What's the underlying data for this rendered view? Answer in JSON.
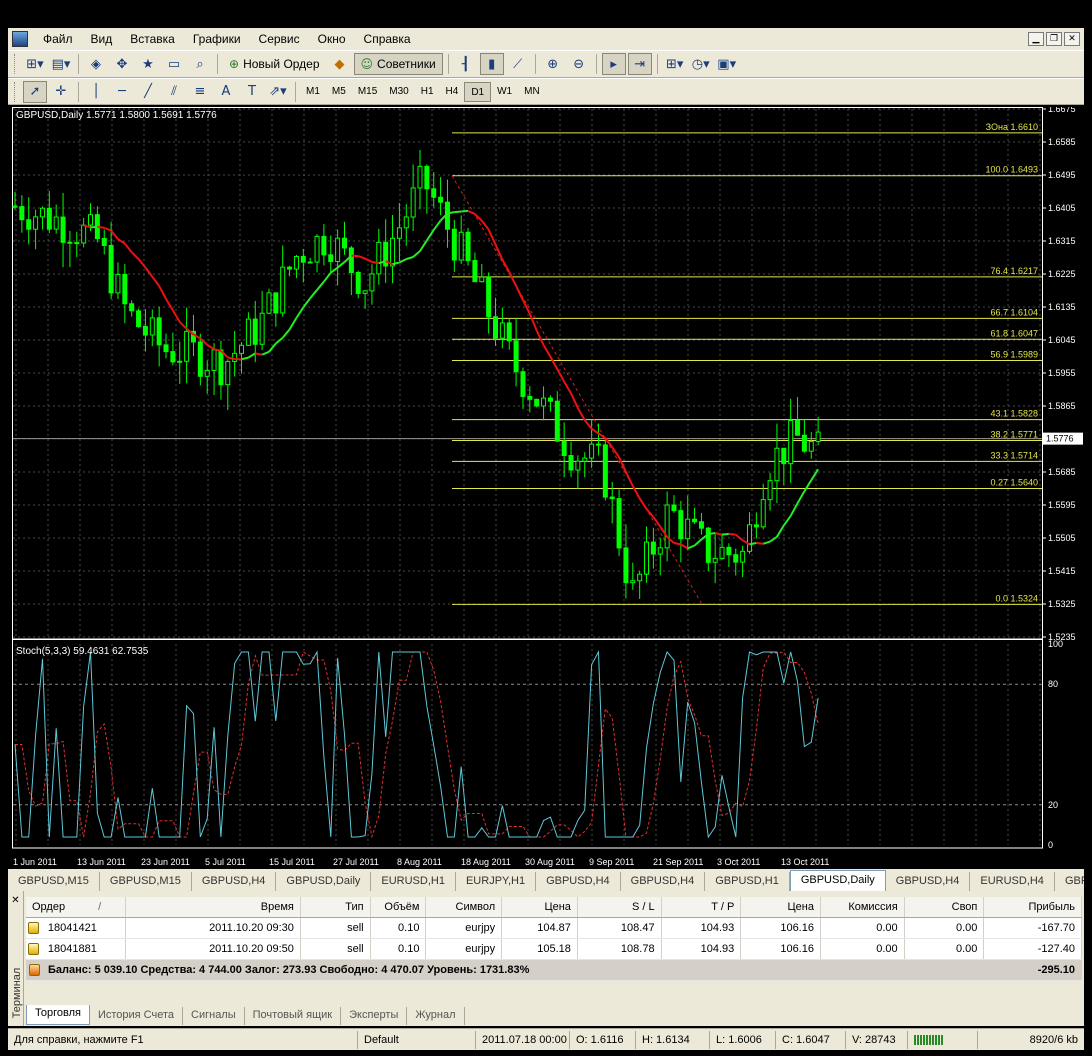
{
  "menu": [
    "Файл",
    "Вид",
    "Вставка",
    "Графики",
    "Сервис",
    "Окно",
    "Справка"
  ],
  "window_buttons": [
    "minimize-icon",
    "restore-icon",
    "close-icon"
  ],
  "toolbar": {
    "new_order_label": "Новый Ордер",
    "experts_label": "Советники"
  },
  "timeframes": [
    "M1",
    "M5",
    "M15",
    "M30",
    "H1",
    "H4",
    "D1",
    "W1",
    "MN"
  ],
  "active_timeframe": "D1",
  "chart": {
    "header": "GBPUSD,Daily  1.5771 1.5800 1.5691 1.5776",
    "current_price": "1.5776",
    "stoch_header": "Stoch(5,3,3) 59.4631 62.7535"
  },
  "chart_data": {
    "type": "candlestick",
    "symbol": "GBPUSD",
    "timeframe": "Daily",
    "ohlc": {
      "open": 1.5771,
      "high": 1.58,
      "low": 1.5691,
      "close": 1.5776
    },
    "price_axis": [
      "1.6675",
      "1.6585",
      "1.6495",
      "1.6405",
      "1.6315",
      "1.6225",
      "1.6135",
      "1.6045",
      "1.5955",
      "1.5865",
      "1.5776",
      "1.5685",
      "1.5595",
      "1.5505",
      "1.5415",
      "1.5325",
      "1.5235"
    ],
    "ylim": [
      1.5235,
      1.6675
    ],
    "date_axis": [
      "1 Jun 2011",
      "13 Jun 2011",
      "23 Jun 2011",
      "5 Jul 2011",
      "15 Jul 2011",
      "27 Jul 2011",
      "8 Aug 2011",
      "18 Aug 2011",
      "30 Aug 2011",
      "9 Sep 2011",
      "21 Sep 2011",
      "3 Oct 2011",
      "13 Oct 2011"
    ],
    "fibonacci": [
      {
        "level": "ЗОна",
        "price": "1.6610"
      },
      {
        "level": "100.0",
        "price": "1.6493"
      },
      {
        "level": "76.4",
        "price": "1.6217"
      },
      {
        "level": "66.7",
        "price": "1.6104"
      },
      {
        "level": "61.8",
        "price": "1.6047"
      },
      {
        "level": "56.9",
        "price": "1.5989"
      },
      {
        "level": "43.1",
        "price": "1.5828"
      },
      {
        "level": "38.2",
        "price": "1.5771"
      },
      {
        "level": "33.3",
        "price": "1.5714"
      },
      {
        "level": "0.27",
        "price": "1.5640"
      },
      {
        "level": "0.0",
        "price": "1.5324"
      }
    ],
    "stochastic": {
      "k": 59.4631,
      "d": 62.7535,
      "axis": [
        "100",
        "80",
        "20",
        "0"
      ],
      "ylim": [
        0,
        100
      ]
    }
  },
  "chart_tabs": [
    "GBPUSD,M15",
    "GBPUSD,M15",
    "GBPUSD,H4",
    "GBPUSD,Daily",
    "EURUSD,H1",
    "EURJPY,H1",
    "GBPUSD,H4",
    "GBPUSD,H4",
    "GBPUSD,H1",
    "GBPUSD,Daily",
    "GBPUSD,H4",
    "EURUSD,H4",
    "GBPUSD,I"
  ],
  "active_chart_tab": 9,
  "terminal": {
    "title": "Терминал",
    "headers": {
      "order": "Ордер",
      "sort": "/",
      "time": "Время",
      "type": "Тип",
      "volume": "Объём",
      "symbol": "Символ",
      "price": "Цена",
      "sl": "S / L",
      "tp": "T / P",
      "cur_price": "Цена",
      "commission": "Комиссия",
      "swap": "Своп",
      "profit": "Прибыль"
    },
    "orders": [
      {
        "order": "18041421",
        "time": "2011.10.20 09:30",
        "type": "sell",
        "volume": "0.10",
        "symbol": "eurjpy",
        "price": "104.87",
        "sl": "108.47",
        "tp": "104.93",
        "cur_price": "106.16",
        "commission": "0.00",
        "swap": "0.00",
        "profit": "-167.70"
      },
      {
        "order": "18041881",
        "time": "2011.10.20 09:50",
        "type": "sell",
        "volume": "0.10",
        "symbol": "eurjpy",
        "price": "105.18",
        "sl": "108.78",
        "tp": "104.93",
        "cur_price": "106.16",
        "commission": "0.00",
        "swap": "0.00",
        "profit": "-127.40"
      }
    ],
    "summary": "Баланс: 5 039.10  Средства: 4 744.00  Залог: 273.93  Свободно: 4 470.07  Уровень: 1731.83%",
    "total_profit": "-295.10",
    "tabs": [
      "Торговля",
      "История Счета",
      "Сигналы",
      "Почтовый ящик",
      "Эксперты",
      "Журнал"
    ]
  },
  "status": {
    "help": "Для справки, нажмите F1",
    "profile": "Default",
    "datetime": "2011.07.18 00:00",
    "open": "O: 1.6116",
    "high": "H: 1.6134",
    "low": "L: 1.6006",
    "close": "C: 1.6047",
    "volume": "V: 28743",
    "traffic": "8920/6 kb"
  },
  "colors": {
    "bull": "#00ff00",
    "bear": "#00ff00",
    "grid": "#4a4a4a",
    "ma_up": "#22ee22",
    "ma_down": "#ee1111",
    "fib": "#e6e64a",
    "stoch_main": "#5fc8d8",
    "stoch_signal": "#e03030"
  }
}
